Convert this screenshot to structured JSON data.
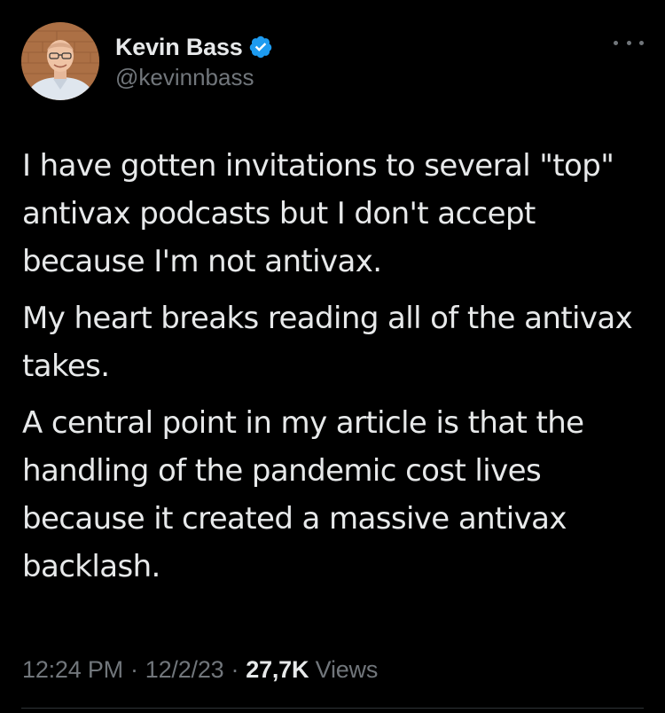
{
  "colors": {
    "background": "#000000",
    "text_primary": "#e7e9ea",
    "text_secondary": "#71767b",
    "verified_badge": "#1d9bf0"
  },
  "author": {
    "display_name": "Kevin Bass",
    "handle": "@kevinnbass",
    "verified": true,
    "avatar_icon": "profile-photo"
  },
  "more_button_icon": "more-horizontal-icon",
  "tweet": {
    "paragraphs": [
      "I have gotten invitations to several \"top\" antivax podcasts but I don't accept because I'm not antivax.",
      "My heart breaks reading all of the antivax takes.",
      "A central point in my article is that the handling of the pandemic cost lives because it created a massive antivax backlash."
    ]
  },
  "meta": {
    "time": "12:24 PM",
    "separator": "·",
    "date": "12/2/23",
    "views_count": "27,7K",
    "views_label": "Views"
  }
}
